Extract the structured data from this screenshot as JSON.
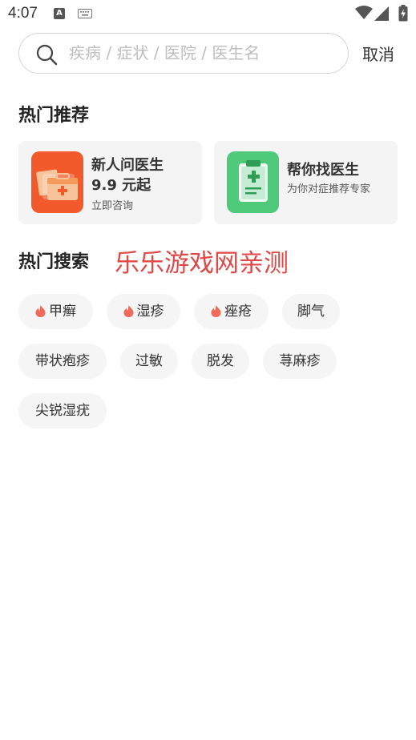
{
  "status_bar": {
    "time": "4:07",
    "notification_letter": "A",
    "icons": [
      "notification-a-icon",
      "keyboard-icon",
      "wifi-icon",
      "cell-signal-icon",
      "battery-charging-icon"
    ]
  },
  "search": {
    "placeholder": "疾病 / 症状 / 医院 / 医生名",
    "value": "",
    "cancel_label": "取消"
  },
  "hot_recommend": {
    "title": "热门推荐",
    "cards": [
      {
        "title": "新人问医生",
        "price": "9.9 元起",
        "subtitle": "立即咨询",
        "icon": "medical-kit-icon",
        "color": "#f25a2c"
      },
      {
        "title": "帮你找医生",
        "subtitle": "为你对症推荐专家",
        "icon": "clipboard-cross-icon",
        "color": "#4fc97a"
      }
    ]
  },
  "hot_search": {
    "title": "热门搜索",
    "promo_text": "乐乐游戏网亲测",
    "promo_color": "#e04848",
    "hot_color": "#f06a5a",
    "tags": [
      {
        "label": "甲癣",
        "hot": true
      },
      {
        "label": "湿疹",
        "hot": true
      },
      {
        "label": "痤疮",
        "hot": true
      },
      {
        "label": "脚气",
        "hot": false
      },
      {
        "label": "带状疱疹",
        "hot": false
      },
      {
        "label": "过敏",
        "hot": false
      },
      {
        "label": "脱发",
        "hot": false
      },
      {
        "label": "荨麻疹",
        "hot": false
      },
      {
        "label": "尖锐湿疣",
        "hot": false
      }
    ]
  }
}
